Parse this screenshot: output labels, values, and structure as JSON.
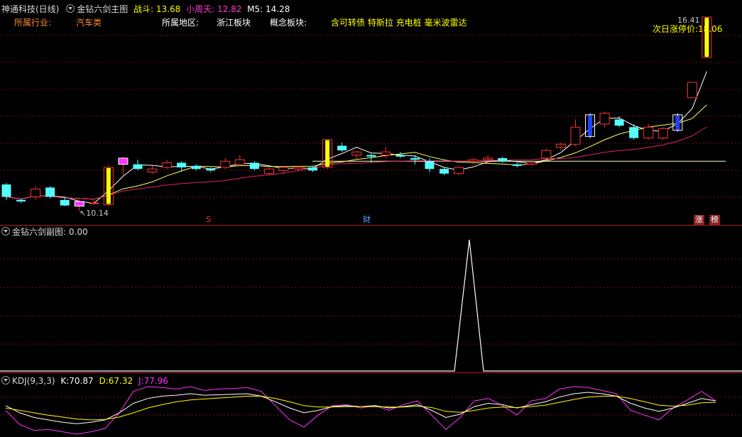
{
  "header": {
    "stock_name": "神通科技(日线)",
    "indicator_main": "金钻六剑主图",
    "zhandou_label": "战斗:",
    "zhandou_value": "13.68",
    "xiaozhoutian_label": "小周天:",
    "xiaozhoutian_value": "12.82",
    "m5_label": "M5:",
    "m5_value": "14.28"
  },
  "info": {
    "industry_label": "所属行业:",
    "industry_value": "汽车类",
    "region_label": "所属地区:",
    "region_value": "浙江板块",
    "concept_label": "概念板块:",
    "concept_value": "含可转债 特斯拉 充电桩 毫米波雷达",
    "limit_label": "次日涨停价:",
    "limit_value": "18.06",
    "high_label": "16.41",
    "low_marker": "10.14"
  },
  "markers": {
    "s_mark": "S",
    "cai_mark": "财",
    "zhang_mark": "涨",
    "bang_mark": "榜"
  },
  "sub_panel": {
    "title": "金钻六剑副图",
    "value_label": ": 0.00"
  },
  "kdj": {
    "title": "KDJ(9,3,3)",
    "k_label": "K:",
    "k_value": "70.87",
    "d_label": "D:",
    "d_value": "67.32",
    "j_label": "J:",
    "j_value": "77.96"
  },
  "colors": {
    "up": "#ff3232",
    "down": "#54ffff",
    "gold": "#ffff00",
    "magenta": "#ff32ff",
    "ma_white": "#ffffff",
    "ma_yellow": "#ffff66",
    "ma_pink": "#e0206a",
    "grid": "#7a1010"
  },
  "chart_data": {
    "type": "candlestick",
    "candles": [
      {
        "o": 11.0,
        "h": 11.05,
        "l": 10.5,
        "c": 10.6
      },
      {
        "o": 10.5,
        "h": 10.55,
        "l": 10.4,
        "c": 10.45
      },
      {
        "o": 10.6,
        "h": 10.95,
        "l": 10.5,
        "c": 10.85
      },
      {
        "o": 10.9,
        "h": 10.95,
        "l": 10.55,
        "c": 10.6
      },
      {
        "o": 10.5,
        "h": 10.55,
        "l": 10.3,
        "c": 10.32
      },
      {
        "o": 10.3,
        "h": 10.5,
        "l": 10.14,
        "c": 10.45
      },
      {
        "o": 10.4,
        "h": 10.5,
        "l": 10.35,
        "c": 10.4
      },
      {
        "o": 10.35,
        "h": 11.6,
        "l": 10.3,
        "c": 11.55
      },
      {
        "o": 11.65,
        "h": 11.9,
        "l": 11.3,
        "c": 11.85
      },
      {
        "o": 11.65,
        "h": 11.8,
        "l": 11.45,
        "c": 11.5
      },
      {
        "o": 11.4,
        "h": 11.6,
        "l": 11.35,
        "c": 11.5
      },
      {
        "o": 11.55,
        "h": 11.8,
        "l": 11.5,
        "c": 11.7
      },
      {
        "o": 11.7,
        "h": 11.75,
        "l": 11.45,
        "c": 11.55
      },
      {
        "o": 11.6,
        "h": 11.65,
        "l": 11.45,
        "c": 11.5
      },
      {
        "o": 11.5,
        "h": 11.55,
        "l": 11.4,
        "c": 11.45
      },
      {
        "o": 11.55,
        "h": 11.85,
        "l": 11.5,
        "c": 11.75
      },
      {
        "o": 11.65,
        "h": 11.95,
        "l": 11.6,
        "c": 11.8
      },
      {
        "o": 11.7,
        "h": 11.75,
        "l": 11.45,
        "c": 11.5
      },
      {
        "o": 11.35,
        "h": 11.55,
        "l": 11.3,
        "c": 11.5
      },
      {
        "o": 11.45,
        "h": 11.6,
        "l": 11.35,
        "c": 11.55
      },
      {
        "o": 11.5,
        "h": 11.6,
        "l": 11.45,
        "c": 11.55
      },
      {
        "o": 11.55,
        "h": 11.6,
        "l": 11.4,
        "c": 11.45
      },
      {
        "o": 11.55,
        "h": 12.45,
        "l": 11.5,
        "c": 12.45
      },
      {
        "o": 12.25,
        "h": 12.35,
        "l": 12.05,
        "c": 12.1
      },
      {
        "o": 11.95,
        "h": 12.1,
        "l": 11.8,
        "c": 12.05
      },
      {
        "o": 11.95,
        "h": 12.0,
        "l": 11.7,
        "c": 11.9
      },
      {
        "o": 11.95,
        "h": 12.2,
        "l": 11.85,
        "c": 12.05
      },
      {
        "o": 11.95,
        "h": 12.05,
        "l": 11.85,
        "c": 11.9
      },
      {
        "o": 11.85,
        "h": 11.95,
        "l": 11.65,
        "c": 11.8
      },
      {
        "o": 11.75,
        "h": 11.85,
        "l": 11.4,
        "c": 11.5
      },
      {
        "o": 11.5,
        "h": 11.55,
        "l": 11.3,
        "c": 11.35
      },
      {
        "o": 11.35,
        "h": 11.6,
        "l": 11.3,
        "c": 11.55
      },
      {
        "o": 11.75,
        "h": 11.85,
        "l": 11.65,
        "c": 11.8
      },
      {
        "o": 11.8,
        "h": 11.95,
        "l": 11.7,
        "c": 11.85
      },
      {
        "o": 11.85,
        "h": 11.9,
        "l": 11.7,
        "c": 11.75
      },
      {
        "o": 11.65,
        "h": 11.7,
        "l": 11.55,
        "c": 11.6
      },
      {
        "o": 11.65,
        "h": 11.75,
        "l": 11.6,
        "c": 11.7
      },
      {
        "o": 11.85,
        "h": 12.15,
        "l": 11.8,
        "c": 12.1
      },
      {
        "o": 12.2,
        "h": 12.35,
        "l": 12.1,
        "c": 12.3
      },
      {
        "o": 12.3,
        "h": 13.1,
        "l": 12.25,
        "c": 12.85
      },
      {
        "o": 12.55,
        "h": 13.3,
        "l": 12.5,
        "c": 13.25
      },
      {
        "o": 12.95,
        "h": 13.35,
        "l": 12.85,
        "c": 13.3
      },
      {
        "o": 13.1,
        "h": 13.2,
        "l": 12.85,
        "c": 12.9
      },
      {
        "o": 12.85,
        "h": 12.95,
        "l": 12.45,
        "c": 12.5
      },
      {
        "o": 12.5,
        "h": 12.95,
        "l": 12.45,
        "c": 12.85
      },
      {
        "o": 12.5,
        "h": 12.85,
        "l": 12.45,
        "c": 12.8
      },
      {
        "o": 12.75,
        "h": 13.3,
        "l": 12.7,
        "c": 13.25
      },
      {
        "o": 13.8,
        "h": 14.3,
        "l": 13.8,
        "c": 14.3
      },
      {
        "o": 15.1,
        "h": 16.41,
        "l": 15.1,
        "c": 16.41
      }
    ],
    "price_range": [
      9.9,
      16.5
    ],
    "kdj_range": [
      0,
      100
    ]
  }
}
